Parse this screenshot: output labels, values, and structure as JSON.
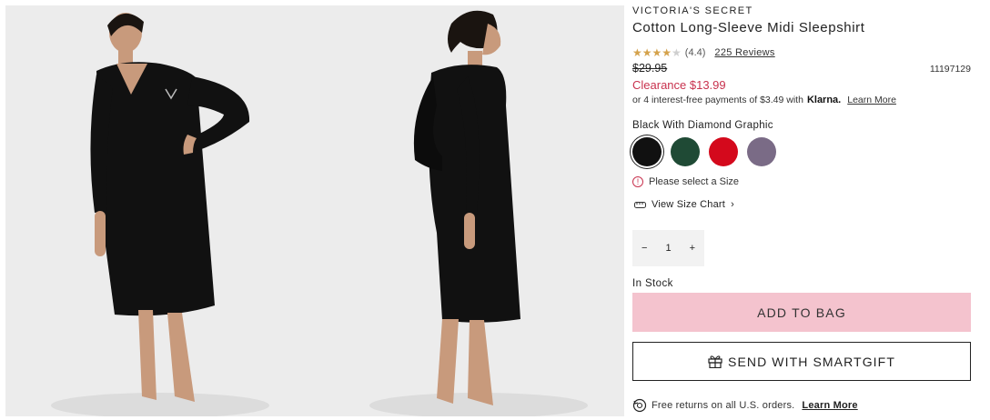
{
  "gallery": {
    "images": [
      {
        "label": "model-front-view"
      },
      {
        "label": "model-side-view"
      }
    ]
  },
  "product": {
    "brand": "VICTORIA'S SECRET",
    "name": "Cotton Long-Sleeve Midi Sleepshirt",
    "rating_value": "(4.4)",
    "rating": 4.4,
    "reviews_label": "225 Reviews",
    "original_price": "$29.95",
    "sale_price": "Clearance $13.99",
    "item_number": "11197129",
    "installments_text": "or 4 interest-free payments of $3.49 with",
    "klarna_label": "Klarna.",
    "installments_link": "Learn More"
  },
  "colors": {
    "selected_name": "Black With Diamond Graphic",
    "swatches": [
      {
        "name": "black",
        "hex": "#111111"
      },
      {
        "name": "green",
        "hex": "#1f4a35"
      },
      {
        "name": "red",
        "hex": "#d4091c"
      },
      {
        "name": "purple",
        "hex": "#7a6b86"
      }
    ]
  },
  "size": {
    "warning": "Please select a Size",
    "chart_link": "View Size Chart"
  },
  "quantity": {
    "minus": "−",
    "value": "1",
    "plus": "+"
  },
  "stock_status": "In Stock",
  "buttons": {
    "add_to_bag": "ADD TO BAG",
    "smartgift": "SEND WITH SMARTGIFT"
  },
  "returns": {
    "text": "Free returns on all U.S. orders.",
    "link": "Learn More"
  },
  "accent": {
    "sale": "#c8324e",
    "add_to_bag_bg": "#f4c3ce"
  }
}
